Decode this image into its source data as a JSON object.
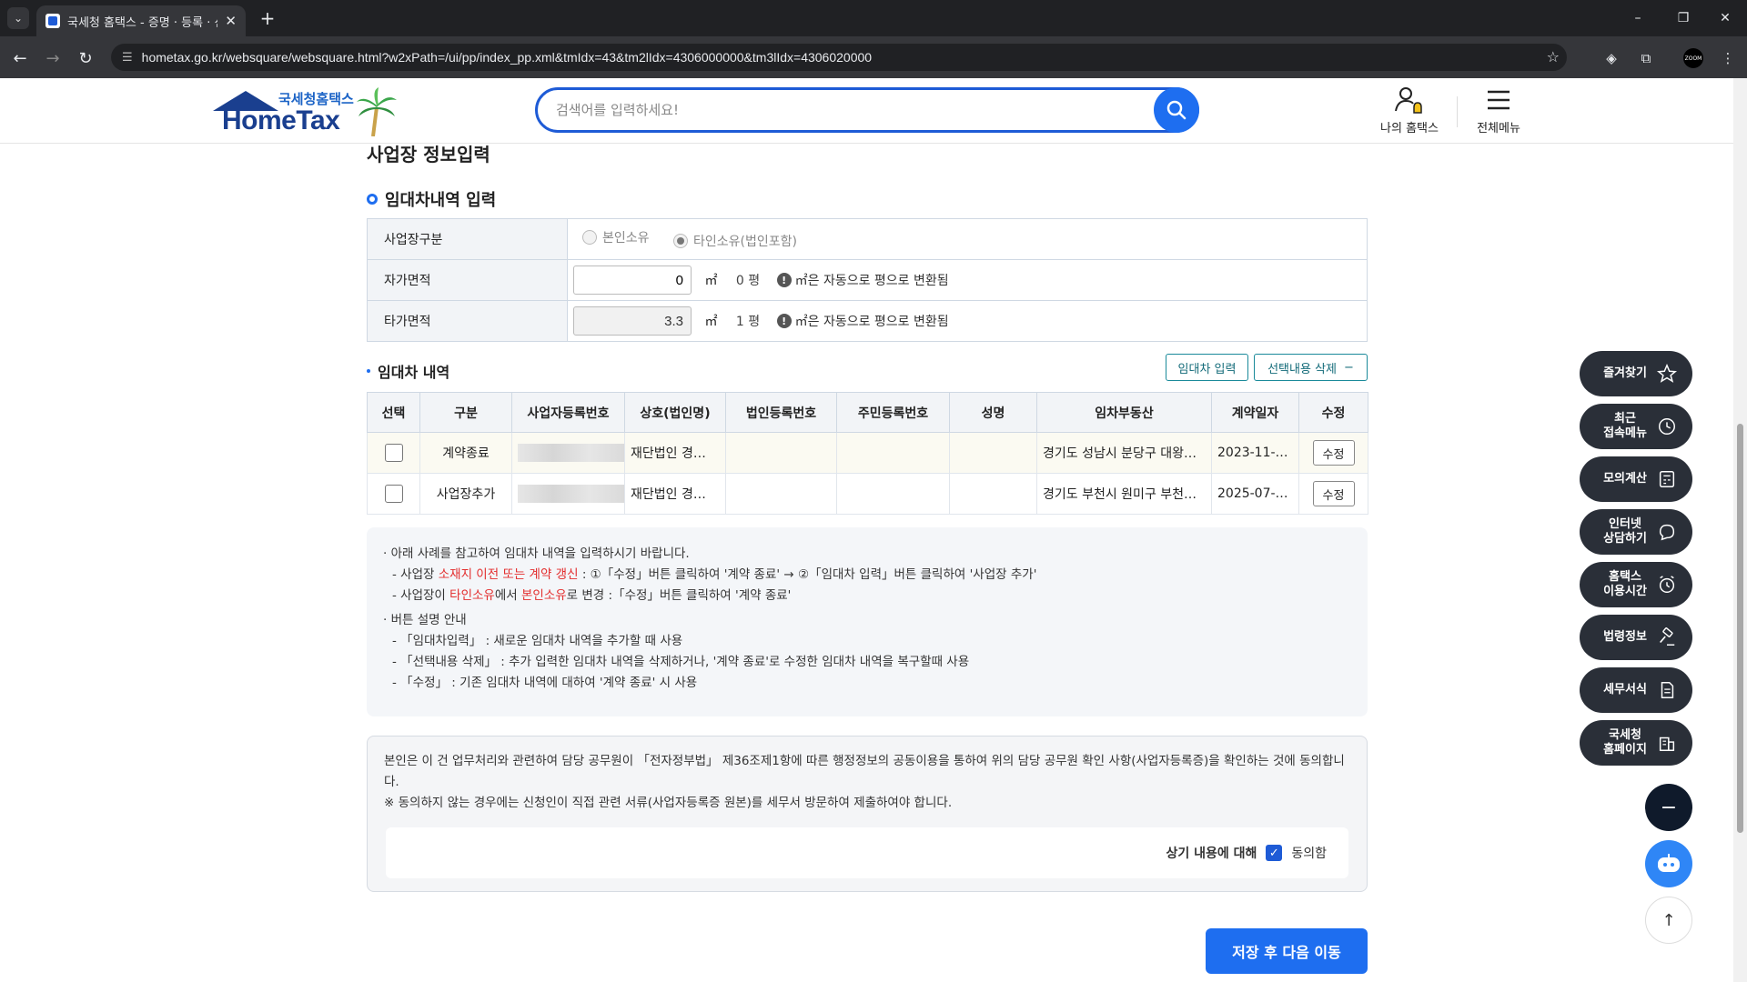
{
  "browser": {
    "tab_title": "국세청 홈택스 - 증명 · 등록 · 신",
    "url": "hometax.go.kr/websquare/websquare.html?w2xPath=/ui/pp/index_pp.xml&tmIdx=43&tm2lIdx=4306000000&tm3lIdx=4306020000",
    "new_tab": "+",
    "minimize": "–",
    "restore": "❐",
    "close": "✕",
    "zoom_ext_label": "ZOOM"
  },
  "header": {
    "logo_sub": "국세청홈택스",
    "logo_main": "HomeTax",
    "search_placeholder": "검색어를 입력하세요!",
    "my_hometax": "나의 홈택스",
    "all_menu": "전체메뉴"
  },
  "page": {
    "title": "사업장 정보입력",
    "section_title": "임대차내역 입력"
  },
  "form": {
    "row1_label": "사업장구분",
    "radio_own": "본인소유",
    "radio_other": "타인소유(법인포함)",
    "row2_label": "자가면적",
    "own_area": "0",
    "own_pyeong": "0 평",
    "row3_label": "타가면적",
    "other_area": "3.3",
    "other_pyeong": "1 평",
    "unit": "㎡",
    "info_text": "㎡은 자동으로 평으로 변환됨"
  },
  "lease": {
    "title": "임대차 내역",
    "btn_input": "임대차 입력",
    "btn_delete": "선택내용 삭제",
    "columns": [
      "선택",
      "구분",
      "사업자등록번호",
      "상호(법인명)",
      "법인등록번호",
      "주민등록번호",
      "성명",
      "임차부동산",
      "계약일자",
      "수정"
    ],
    "rows": [
      {
        "type": "계약종료",
        "name": "재단법인 경…",
        "property": "경기도 성남시 분당구 대왕…",
        "date": "2023-11-…",
        "edit": "수정"
      },
      {
        "type": "사업장추가",
        "name": "재단법인 경…",
        "property": "경기도 부천시 원미구 부천…",
        "date": "2025-07-…",
        "edit": "수정"
      }
    ]
  },
  "guide": {
    "l1": "아래 사례를 참고하여 임대차 내역을 입력하시기 바랍니다.",
    "l2a": "사업장 ",
    "l2b": "소재지 이전 또는 계약 갱신",
    "l2c": " : ①「수정」버튼 클릭하여 '계약 종료' → ②「임대차 입력」버튼 클릭하여 '사업장 추가'",
    "l3a": "사업장이 ",
    "l3b": "타인소유",
    "l3c": "에서 ",
    "l3d": "본인소유",
    "l3e": "로 변경 :「수정」버튼 클릭하여 '계약 종료'",
    "l4": "버튼 설명 안내",
    "l5": "「임대차입력」 : 새로운 임대차 내역을 추가할 때 사용",
    "l6": "「선택내용 삭제」 : 추가 입력한 임대차 내역을 삭제하거나, '계약 종료'로 수정한 임대차 내역을 복구할때 사용",
    "l7": "「수정」 : 기존 임대차 내역에 대하여 '계약 종료' 시 사용"
  },
  "consent": {
    "text1": "본인은 이 건 업무처리와 관련하여 담당 공무원이 「전자정부법」 제36조제1항에 따른 행정정보의 공동이용을 통하여 위의 담당 공무원 확인 사항(사업자등록증)을 확인하는 것에 동의합니다.",
    "text2": "※ 동의하지 않는 경우에는 신청인이 직접 관련 서류(사업자등록증 원본)를 세무서 방문하여 제출하여야 합니다.",
    "label": "상기 내용에 대해",
    "agree": "동의함"
  },
  "actions": {
    "save_next": "저장 후 다음 이동"
  },
  "quick_menu": [
    {
      "label": "즐겨찾기",
      "icon": "star-icon"
    },
    {
      "label": "최근\n접속메뉴",
      "icon": "clock-icon"
    },
    {
      "label": "모의계산",
      "icon": "calculator-icon"
    },
    {
      "label": "인터넷\n상담하기",
      "icon": "chat-icon"
    },
    {
      "label": "홈택스\n이용시간",
      "icon": "alarm-icon"
    },
    {
      "label": "법령정보",
      "icon": "gavel-icon"
    },
    {
      "label": "세무서식",
      "icon": "document-icon"
    },
    {
      "label": "국세청\n홈페이지",
      "icon": "building-icon"
    }
  ],
  "colors": {
    "primary": "#1e6ef0",
    "quick_bg": "#2a2f38",
    "highlight_red": "#e32d2d"
  }
}
